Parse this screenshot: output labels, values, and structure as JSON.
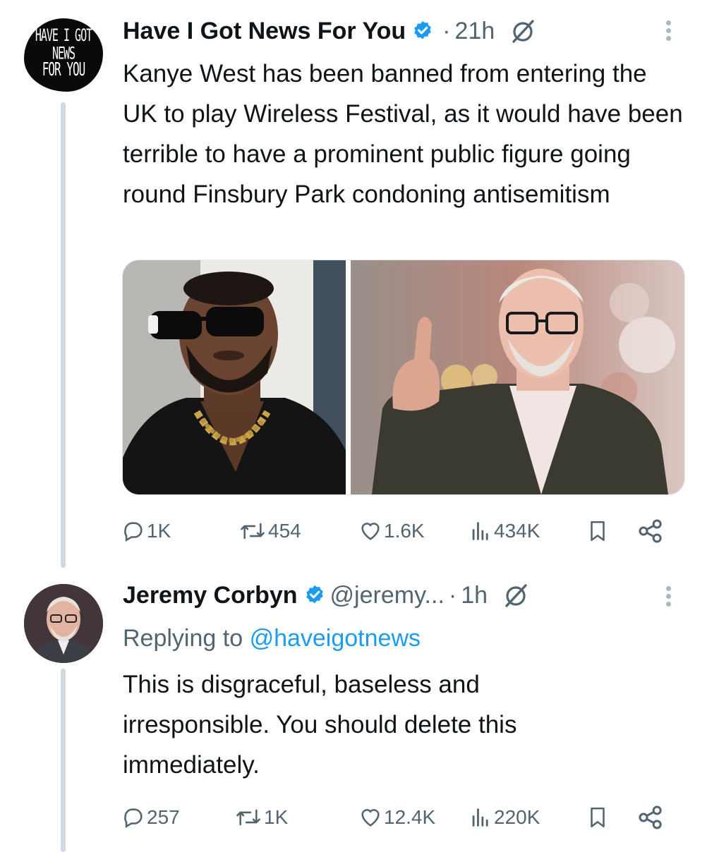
{
  "tweets": [
    {
      "author": "Have I Got News For You",
      "avatar_text": [
        "HAVE I GOT NEWS",
        "FOR YOU"
      ],
      "verified": true,
      "time": "21h",
      "text": "Kanye West has been banned from entering the UK to play Wireless Festival, as it would have been terrible to have a prominent public figure going round Finsbury Park condoning antisemitism",
      "actions": {
        "replies": "1K",
        "reposts": "454",
        "likes": "1.6K",
        "views": "434K"
      }
    },
    {
      "author": "Jeremy Corbyn",
      "verified": true,
      "handle": "@jeremy...",
      "time": "1h",
      "reply_label": "Replying to",
      "reply_mention": "@haveigotnews",
      "text": "This is disgraceful, baseless and irresponsible. You should delete this immediately.",
      "actions": {
        "replies": "257",
        "reposts": "1K",
        "likes": "12.4K",
        "views": "220K"
      }
    }
  ],
  "icons": {
    "verified": "verified-badge-icon",
    "grok": "grok-icon",
    "more": "more-vertical-icon",
    "reply": "reply-icon",
    "repost": "repost-icon",
    "like": "like-icon",
    "views": "views-icon",
    "bookmark": "bookmark-icon",
    "share": "share-icon"
  },
  "colors": {
    "accent": "#1d9bf0",
    "text": "#0f1419",
    "muted": "#536471",
    "thread_line": "#cfd9de"
  }
}
